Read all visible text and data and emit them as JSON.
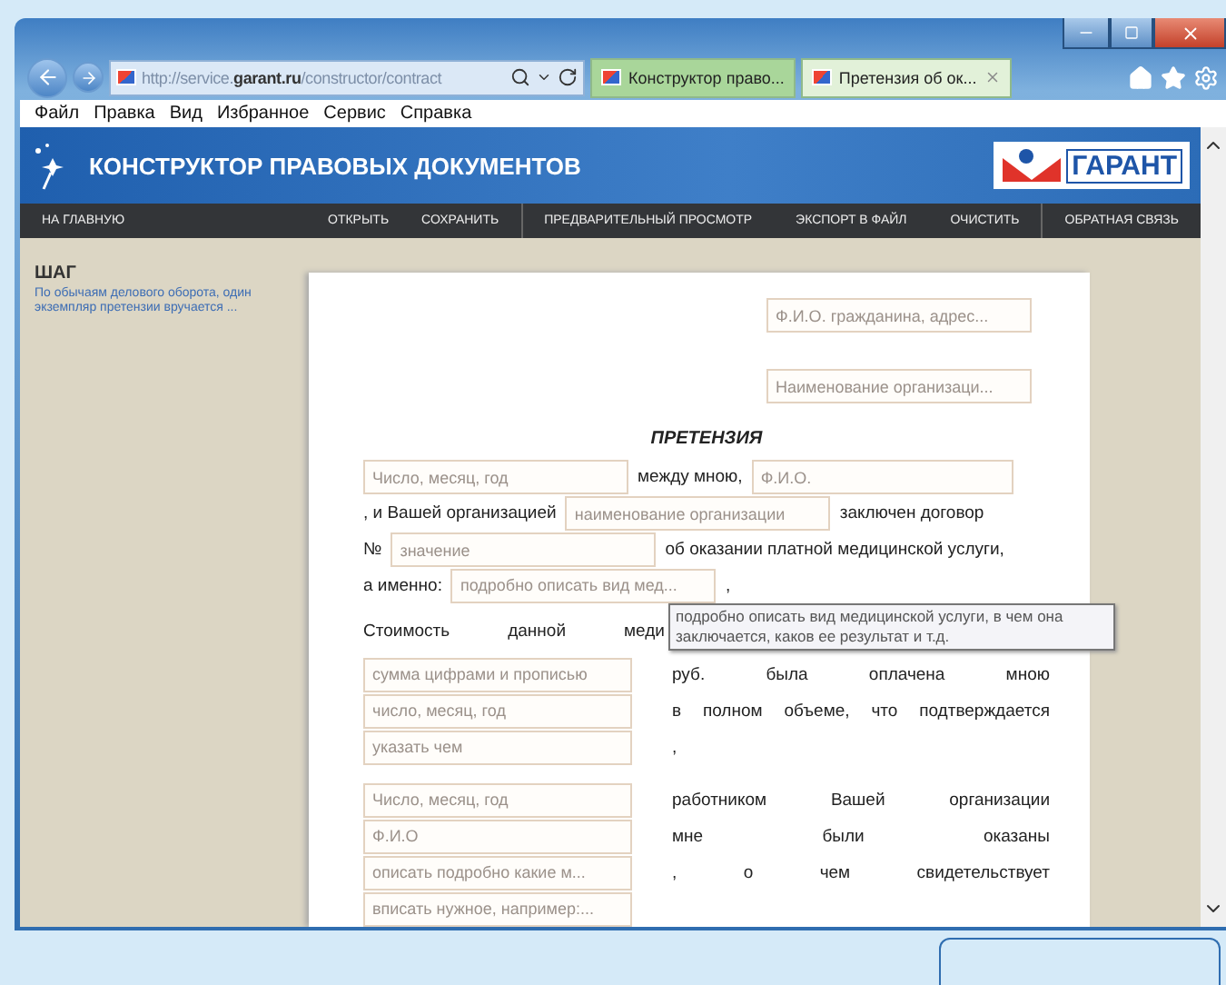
{
  "browser": {
    "address": "http://service.**garant.ru**/constructor/contract",
    "tabs": [
      {
        "label": "Конструктор право...",
        "selected": false
      },
      {
        "label": "Претензия об ок...",
        "selected": true
      }
    ],
    "menu": [
      "Файл",
      "Правка",
      "Вид",
      "Избранное",
      "Сервис",
      "Справка"
    ]
  },
  "header": {
    "title": "КОНСТРУКТОР ПРАВОВЫХ ДОКУМЕНТОВ",
    "logo_text": "ГАРАНТ"
  },
  "nav": [
    [
      "НА ГЛАВНУЮ",
      "ОТКРЫТЬ",
      "СОХРАНИТЬ"
    ],
    [
      "ПРЕДВАРИТЕЛЬНЫЙ ПРОСМОТР",
      "ЭКСПОРТ В ФАЙЛ",
      "ОЧИСТИТЬ"
    ],
    [
      "ОБРАТНАЯ СВЯЗЬ"
    ]
  ],
  "sidebar": {
    "heading": "ШАГ",
    "hint": "По обычаям делового оборота, один экземпляр претензии вручается ..."
  },
  "document": {
    "addressee_fields": [
      {
        "placeholder": "Ф.И.О. гражданина, адрес..."
      },
      {
        "placeholder": "Наименование организаци..."
      }
    ],
    "title": "ПРЕТЕНЗИЯ",
    "lines": [
      {
        "parts": [
          {
            "kind": "field",
            "placeholder": "Число, месяц, год"
          },
          {
            "kind": "text",
            "text": "между мною,"
          },
          {
            "kind": "field",
            "placeholder": "Ф.И.О."
          }
        ]
      },
      {
        "parts": [
          {
            "kind": "text",
            "text": ", и Вашей организацией"
          },
          {
            "kind": "field",
            "placeholder": "наименование организации"
          },
          {
            "kind": "text",
            "text": "заключен договор"
          }
        ]
      },
      {
        "parts": [
          {
            "kind": "text",
            "text": "№"
          },
          {
            "kind": "field",
            "placeholder": "значение"
          },
          {
            "kind": "text",
            "text": "об оказании платной медицинской услуги,"
          }
        ]
      },
      {
        "parts": [
          {
            "kind": "text",
            "text": "а именно:"
          },
          {
            "kind": "field",
            "placeholder": "подробно описать вид мед..."
          },
          {
            "kind": "text",
            "text": ","
          }
        ]
      }
    ],
    "spread_text": "Стоимость данной меди",
    "tooltip": "подробно описать вид медицинской услуги, в чем она заключается, каков ее результат и т.д.",
    "pair_groups": [
      [
        {
          "placeholder": "сумма цифрами и прописью",
          "text": "руб. была оплачена мною"
        },
        {
          "placeholder": "число, месяц, год",
          "text": "в полном объеме, что подтверждается"
        },
        {
          "placeholder": "указать чем",
          "text": ","
        }
      ],
      [
        {
          "placeholder": "Число, месяц, год",
          "text": "работником Вашей организации"
        },
        {
          "placeholder": "Ф.И.О",
          "text": "мне были оказаны"
        },
        {
          "placeholder": "описать подробно какие м...",
          "text": ", о чем свидетельствует"
        },
        {
          "placeholder": "вписать нужное, например:..."
        }
      ]
    ]
  }
}
